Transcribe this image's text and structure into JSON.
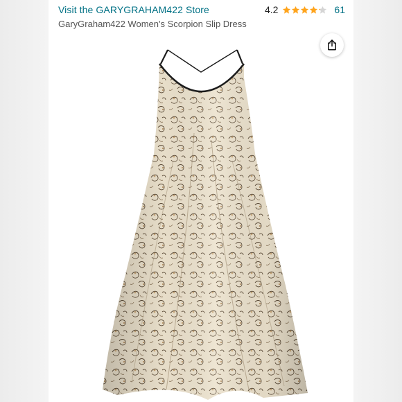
{
  "header": {
    "store_link": "Visit the GARYGRAHAM422 Store",
    "rating_value": "4.2",
    "rating_stars": 4.2,
    "rating_count": "61",
    "product_title": "GaryGraham422 Women's Scorpion Slip Dress"
  },
  "icons": {
    "share": "share-icon",
    "star": "star-icon"
  },
  "colors": {
    "link": "#007185",
    "star": "#ffa41c",
    "star_empty": "#d5d5d5",
    "dress_base": "#e9dcc2",
    "dress_print": "#5b4a36",
    "trim": "#1c1c1c"
  }
}
